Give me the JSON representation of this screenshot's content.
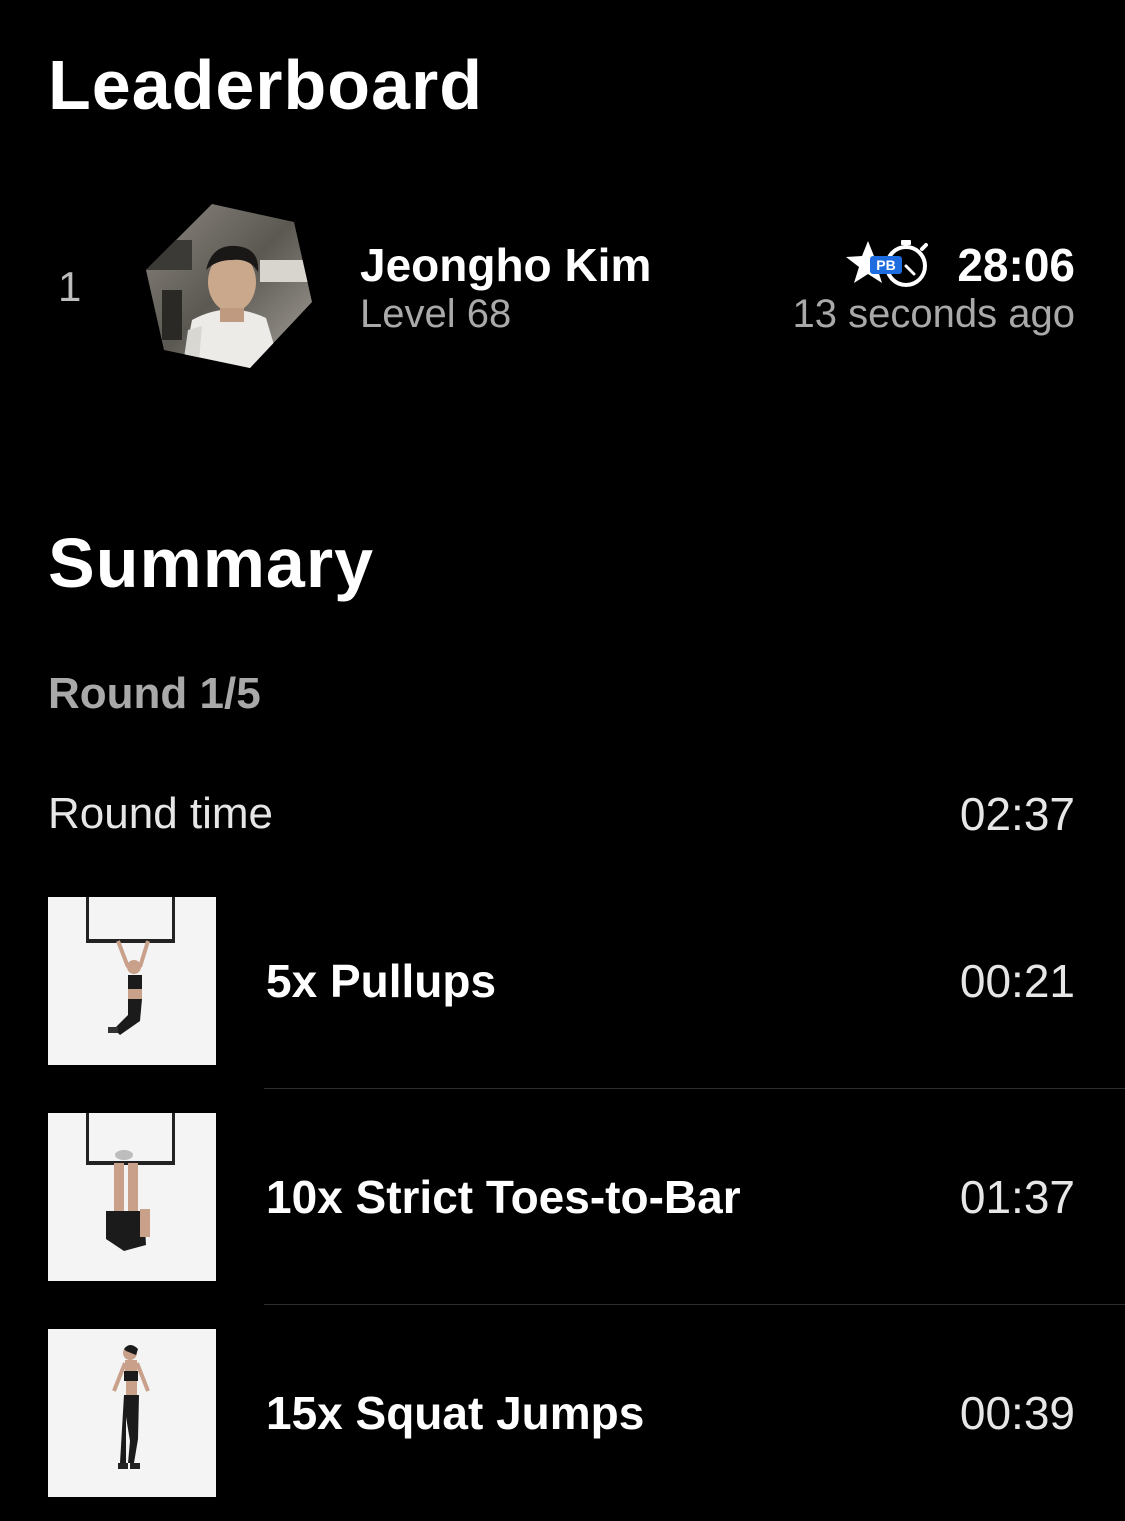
{
  "colors": {
    "background": "#000000",
    "primary_text": "#ffffff",
    "secondary_text": "#a9a9a9",
    "pb_badge": "#1e6de0"
  },
  "leaderboard": {
    "title": "Leaderboard",
    "entries": [
      {
        "rank": "1",
        "name": "Jeongho Kim",
        "level": "Level 68",
        "badge_icon": "personal-best-stopwatch-icon",
        "badge_text": "PB",
        "time": "28:06",
        "when": "13 seconds ago"
      }
    ]
  },
  "summary": {
    "title": "Summary",
    "round": "Round 1/5",
    "round_time_label": "Round time",
    "round_time_value": "02:37",
    "exercises": [
      {
        "name": "5x Pullups",
        "time": "00:21",
        "image": "pullups-image"
      },
      {
        "name": "10x Strict Toes-to-Bar",
        "time": "01:37",
        "image": "toes-to-bar-image"
      },
      {
        "name": "15x Squat Jumps",
        "time": "00:39",
        "image": "squat-jumps-image"
      }
    ]
  }
}
